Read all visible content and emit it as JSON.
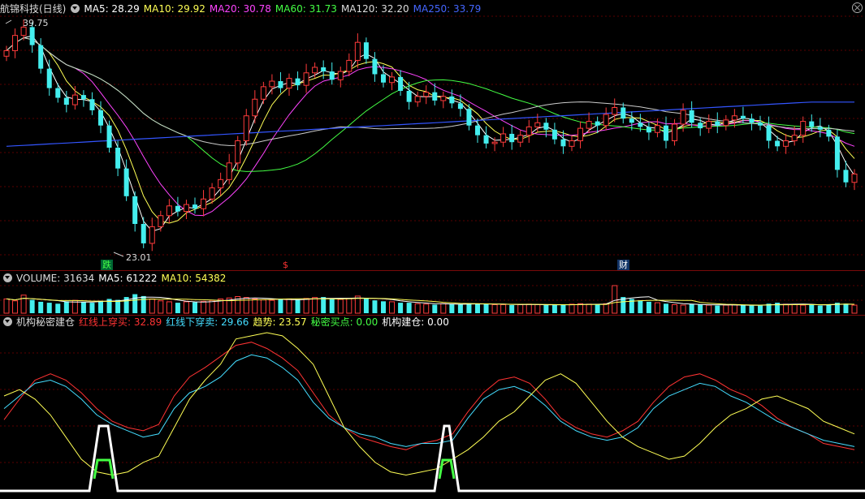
{
  "main_header": {
    "stock": "航锦科技(日线)",
    "ma5": {
      "label": "MA5: 28.29",
      "color": "#ffffff"
    },
    "ma10": {
      "label": "MA10: 29.92",
      "color": "#ffff55"
    },
    "ma20": {
      "label": "MA20: 30.78",
      "color": "#ff44ff"
    },
    "ma60": {
      "label": "MA60: 31.73",
      "color": "#44ff44"
    },
    "ma120": {
      "label": "MA120: 32.20",
      "color": "#dddddd"
    },
    "ma250": {
      "label": "MA250: 33.79",
      "color": "#4466ff"
    }
  },
  "price_marks": {
    "high": "39.75",
    "low": "23.01"
  },
  "event_marks": [
    {
      "label": "跌",
      "color": "#44ff44"
    },
    {
      "label": "$",
      "color": "#ff3333"
    },
    {
      "label": "财",
      "color": "#ffffff"
    }
  ],
  "volume_header": {
    "title": {
      "label": "VOLUME: 31634",
      "color": "#dddddd"
    },
    "ma5": {
      "label": "MA5: 61222",
      "color": "#ffffff"
    },
    "ma10": {
      "label": "MA10: 54382",
      "color": "#ffff55"
    }
  },
  "indicator_header": {
    "title": {
      "label": "机构秘密建仓",
      "color": "#dddddd"
    },
    "red": {
      "label": "红线上穿买: 32.89",
      "color": "#ff3333"
    },
    "cyan": {
      "label": "红线下穿卖: 29.66",
      "color": "#44ddff"
    },
    "trend": {
      "label": "趋势: 23.57",
      "color": "#ffff55"
    },
    "secret": {
      "label": "秘密买点: 0.00",
      "color": "#44ff44"
    },
    "inst": {
      "label": "机构建仓: 0.00",
      "color": "#ffffff"
    }
  },
  "chart_data": {
    "type": "candlestick",
    "price_range": [
      23.01,
      39.75
    ],
    "candles_close": [
      37.5,
      38.6,
      39.2,
      37.9,
      36.2,
      34.8,
      34.1,
      33.6,
      34.3,
      34.0,
      33.2,
      32.1,
      30.5,
      29.0,
      27.0,
      25.0,
      23.6,
      24.8,
      25.6,
      26.3,
      25.9,
      26.4,
      26.1,
      26.8,
      27.6,
      28.2,
      29.4,
      31.0,
      32.8,
      34.0,
      34.9,
      35.3,
      34.8,
      35.5,
      35.0,
      35.9,
      36.3,
      36.0,
      35.4,
      36.0,
      36.8,
      38.1,
      36.9,
      35.8,
      35.2,
      35.6,
      34.6,
      33.8,
      34.2,
      34.5,
      33.9,
      34.2,
      33.7,
      33.3,
      32.1,
      31.4,
      30.8,
      30.9,
      31.5,
      30.9,
      31.4,
      32.0,
      32.3,
      31.8,
      31.1,
      30.6,
      31.0,
      31.9,
      32.4,
      32.1,
      32.9,
      33.4,
      32.6,
      32.3,
      32.0,
      31.6,
      32.1,
      31.0,
      32.2,
      33.2,
      32.3,
      31.9,
      32.4,
      32.1,
      32.5,
      32.8,
      32.6,
      32.3,
      32.1,
      31.0,
      30.6,
      31.0,
      31.4,
      32.4,
      32.0,
      31.8,
      31.3,
      28.9,
      28.0,
      28.6
    ],
    "volumes": [
      30,
      26,
      38,
      28,
      24,
      22,
      20,
      25,
      27,
      23,
      22,
      26,
      30,
      28,
      34,
      40,
      36,
      30,
      26,
      24,
      22,
      24,
      23,
      25,
      27,
      30,
      32,
      35,
      33,
      30,
      28,
      27,
      29,
      30,
      28,
      31,
      33,
      34,
      30,
      29,
      31,
      36,
      32,
      27,
      25,
      24,
      22,
      22,
      20,
      19,
      18,
      20,
      19,
      18,
      21,
      20,
      19,
      18,
      18,
      17,
      18,
      19,
      18,
      17,
      17,
      18,
      19,
      20,
      19,
      18,
      20,
      58,
      34,
      30,
      27,
      24,
      22,
      20,
      18,
      17,
      19,
      18,
      17,
      16,
      17,
      18,
      17,
      16,
      16,
      20,
      22,
      19,
      18,
      17,
      18,
      16,
      19,
      22,
      20,
      17
    ],
    "indicator": {
      "red": [
        45,
        58,
        70,
        74,
        70,
        62,
        52,
        44,
        40,
        38,
        42,
        60,
        72,
        78,
        85,
        92,
        94,
        90,
        84,
        76,
        62,
        48,
        40,
        34,
        31,
        28,
        26,
        30,
        32,
        36,
        50,
        62,
        70,
        72,
        68,
        58,
        46,
        40,
        36,
        34,
        38,
        44,
        56,
        66,
        72,
        74,
        70,
        64,
        60,
        54,
        46,
        40,
        36,
        30,
        28,
        26
      ],
      "cyan": [
        52,
        60,
        68,
        70,
        66,
        58,
        48,
        42,
        38,
        34,
        36,
        52,
        62,
        66,
        72,
        82,
        86,
        84,
        78,
        70,
        56,
        46,
        40,
        36,
        34,
        30,
        28,
        30,
        30,
        32,
        46,
        58,
        64,
        66,
        62,
        54,
        44,
        38,
        34,
        32,
        34,
        40,
        52,
        60,
        64,
        68,
        66,
        60,
        56,
        50,
        44,
        40,
        36,
        32,
        30,
        28
      ],
      "yellow": [
        60,
        64,
        58,
        48,
        34,
        20,
        12,
        10,
        12,
        18,
        22,
        40,
        58,
        70,
        80,
        96,
        98,
        100,
        98,
        90,
        80,
        60,
        40,
        28,
        18,
        12,
        10,
        12,
        14,
        20,
        26,
        34,
        44,
        50,
        60,
        70,
        74,
        68,
        56,
        44,
        34,
        28,
        24,
        20,
        22,
        30,
        40,
        48,
        52,
        58,
        60,
        56,
        52,
        44,
        40,
        36
      ],
      "inst_spikes": [
        [
          110,
          145
        ],
        [
          535,
          565
        ]
      ]
    }
  }
}
